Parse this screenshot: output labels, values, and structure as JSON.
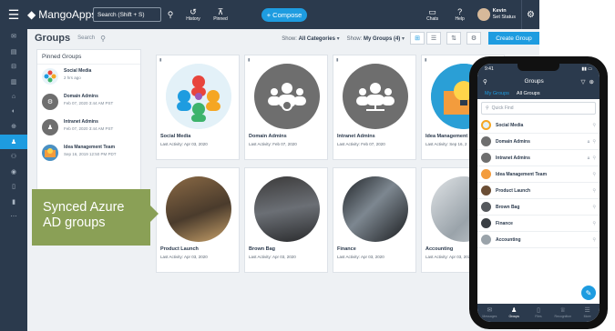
{
  "topbar": {
    "brand": "MangoApps",
    "search_placeholder": "Search (Shift + S)",
    "history_label": "History",
    "pinned_label": "Pinned",
    "compose_label": "+ Compose",
    "chats_label": "Chats",
    "help_label": "Help",
    "user_name": "Kevin",
    "user_status": "Set Status"
  },
  "page": {
    "title": "Groups",
    "search_label": "Search",
    "show_label_1": "Show:",
    "category_filter": "All Categories",
    "show_label_2": "Show:",
    "groups_filter": "My Groups (4)",
    "create_button": "Create Group"
  },
  "pinned": {
    "heading": "Pinned Groups",
    "items": [
      {
        "title": "Social Media",
        "sub": "2 hrs ago"
      },
      {
        "title": "Domain Admins",
        "sub": "Feb 07, 2020 3:44 AM PST"
      },
      {
        "title": "Intranet Admins",
        "sub": "Feb 07, 2020 3:44 AM PST"
      },
      {
        "title": "Idea Management Team",
        "sub": "Sep 16, 2019 12:50 PM PDT"
      }
    ]
  },
  "cards": [
    {
      "title": "Social Media",
      "activity": "Last Activity: Apr 03, 2020"
    },
    {
      "title": "Domain Admins",
      "activity": "Last Activity: Feb 07, 2020"
    },
    {
      "title": "Intranet Admins",
      "activity": "Last Activity: Feb 07, 2020"
    },
    {
      "title": "Idea Management",
      "activity": "Last Activity: Sep 16, 2"
    },
    {
      "title": "Product Launch",
      "activity": "Last Activity: Apr 03, 2020"
    },
    {
      "title": "Brown Bag",
      "activity": "Last Activity: Apr 03, 2020"
    },
    {
      "title": "Finance",
      "activity": "Last Activity: Apr 03, 2020"
    },
    {
      "title": "Accounting",
      "activity": "Last Activity: Apr 03, 2020"
    }
  ],
  "callout": {
    "line1": "Synced Azure",
    "line2": "AD groups"
  },
  "phone": {
    "time": "9:41",
    "title": "Groups",
    "tab_my": "My Groups",
    "tab_all": "All Groups",
    "search_placeholder": "Quick Find",
    "items": [
      {
        "name": "Social Media"
      },
      {
        "name": "Domain Admins"
      },
      {
        "name": "Intranet Admins"
      },
      {
        "name": "Idea Management Team"
      },
      {
        "name": "Product Launch"
      },
      {
        "name": "Brown Bag"
      },
      {
        "name": "Finance"
      },
      {
        "name": "Accounting"
      }
    ],
    "bottom_nav": [
      "Messages",
      "Groups",
      "Files",
      "Recognition",
      "More"
    ]
  },
  "colors": {
    "nav_dark": "#2b3a4d",
    "accent_blue": "#1e9ce0",
    "callout_green": "#8aa056"
  }
}
